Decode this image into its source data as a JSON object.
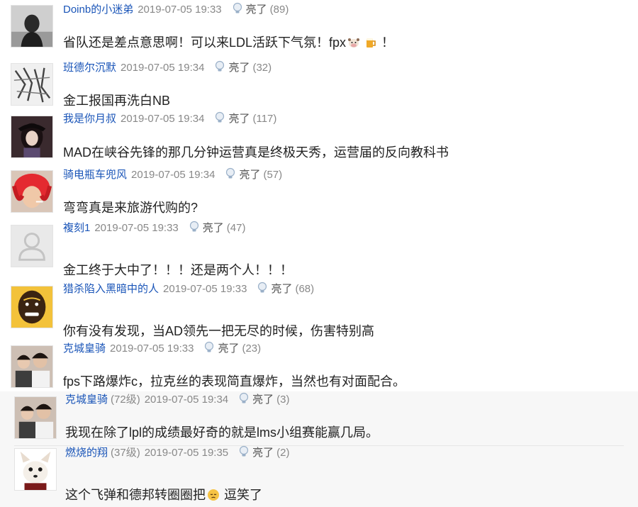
{
  "colors": {
    "username": "#1a55b8",
    "meta_gray": "#888888",
    "text": "#222222"
  },
  "comments": [
    {
      "username": "Doinb的小迷弟",
      "level": "",
      "time": "2019-07-05 19:33",
      "like_label": "亮了",
      "count": "(89)",
      "text": "省队还是差点意思啊！可以来LDL活跃下气氛！fpx",
      "text_tail": "！",
      "emojis": [
        "cow-face-emoji",
        "beer-mug-emoji"
      ]
    },
    {
      "username": "班德尔沉默",
      "level": "",
      "time": "2019-07-05 19:34",
      "like_label": "亮了",
      "count": "(32)",
      "text": "金工报国再洗白NB"
    },
    {
      "username": "我是你月叔",
      "level": "",
      "time": "2019-07-05 19:34",
      "like_label": "亮了",
      "count": "(117)",
      "text": "MAD在峡谷先锋的那几分钟运营真是终极天秀，运营届的反向教科书"
    },
    {
      "username": "骑电瓶车兜风",
      "level": "",
      "time": "2019-07-05 19:34",
      "like_label": "亮了",
      "count": "(57)",
      "text": "弯弯真是来旅游代购的?"
    },
    {
      "username": "複刻1",
      "level": "",
      "time": "2019-07-05 19:33",
      "like_label": "亮了",
      "count": "(47)",
      "text": "金工终于大中了！！！还是两个人！！！"
    },
    {
      "username": "猎杀陷入黑暗中的人",
      "level": "",
      "time": "2019-07-05 19:33",
      "like_label": "亮了",
      "count": "(68)",
      "text": "你有没有发现，当AD领先一把无尽的时候，伤害特别高"
    },
    {
      "username": "克城皇骑",
      "level": "",
      "time": "2019-07-05 19:33",
      "like_label": "亮了",
      "count": "(23)",
      "text": "fps下路爆炸c，拉克丝的表现简直爆炸，当然也有对面配合。"
    },
    {
      "username": "克城皇骑",
      "level": "(72级)",
      "time": "2019-07-05 19:34",
      "like_label": "亮了",
      "count": "(3)",
      "text": "我现在除了lpl的成绩最好奇的就是lms小组赛能赢几局。"
    },
    {
      "username": "燃烧的翔",
      "level": "(37级)",
      "time": "2019-07-05 19:35",
      "like_label": "亮了",
      "count": "(2)",
      "text": "这个飞弹和德邦转圈圈把",
      "text_tail": "逗笑了",
      "emojis": [
        "pensive-face-emoji"
      ]
    }
  ]
}
